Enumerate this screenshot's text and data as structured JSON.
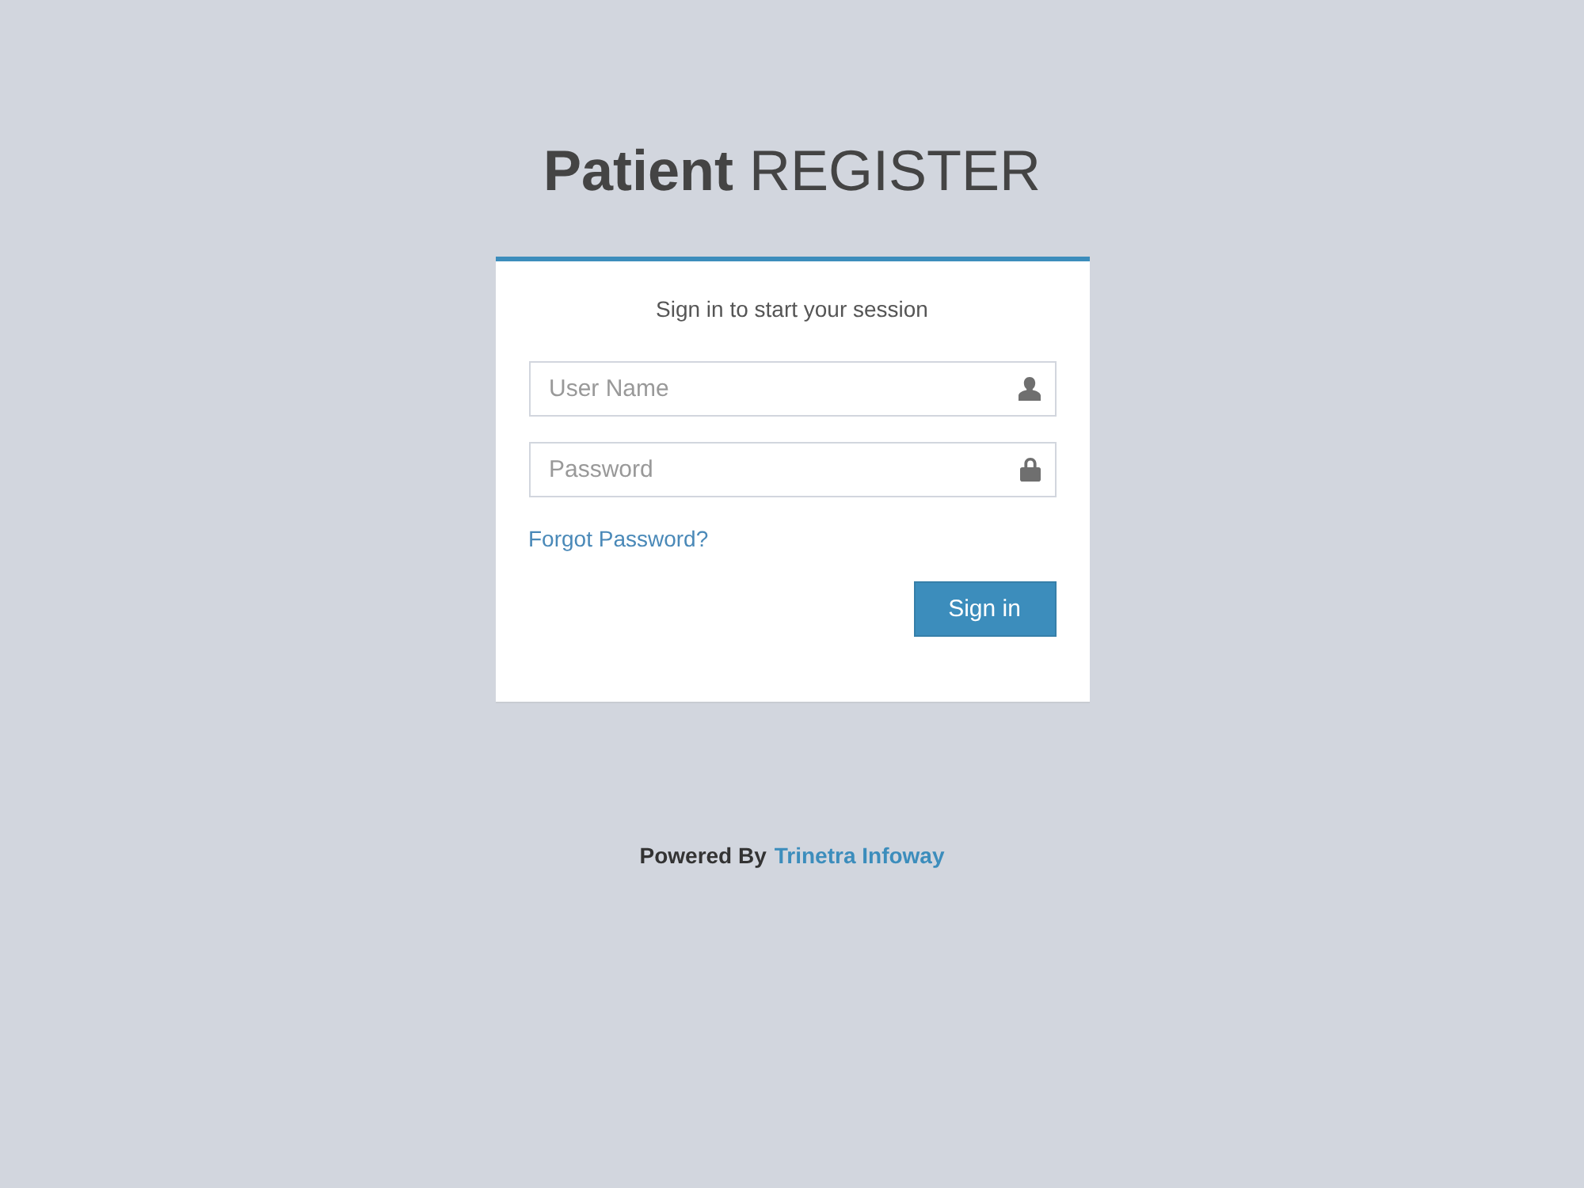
{
  "title": "**Patient** REGISTER",
  "login_box": {
    "message": "Sign in to start your session",
    "fields": [
      {
        "kind": "text",
        "placeholder": "User Name"
      },
      {
        "kind": "password",
        "placeholder": "Password"
      }
    ],
    "forgot_link": "Forgot Password?",
    "submit_button": "Sign in"
  },
  "footer": {
    "label": "Powered By",
    "link": "Trinetra Infoway"
  }
}
